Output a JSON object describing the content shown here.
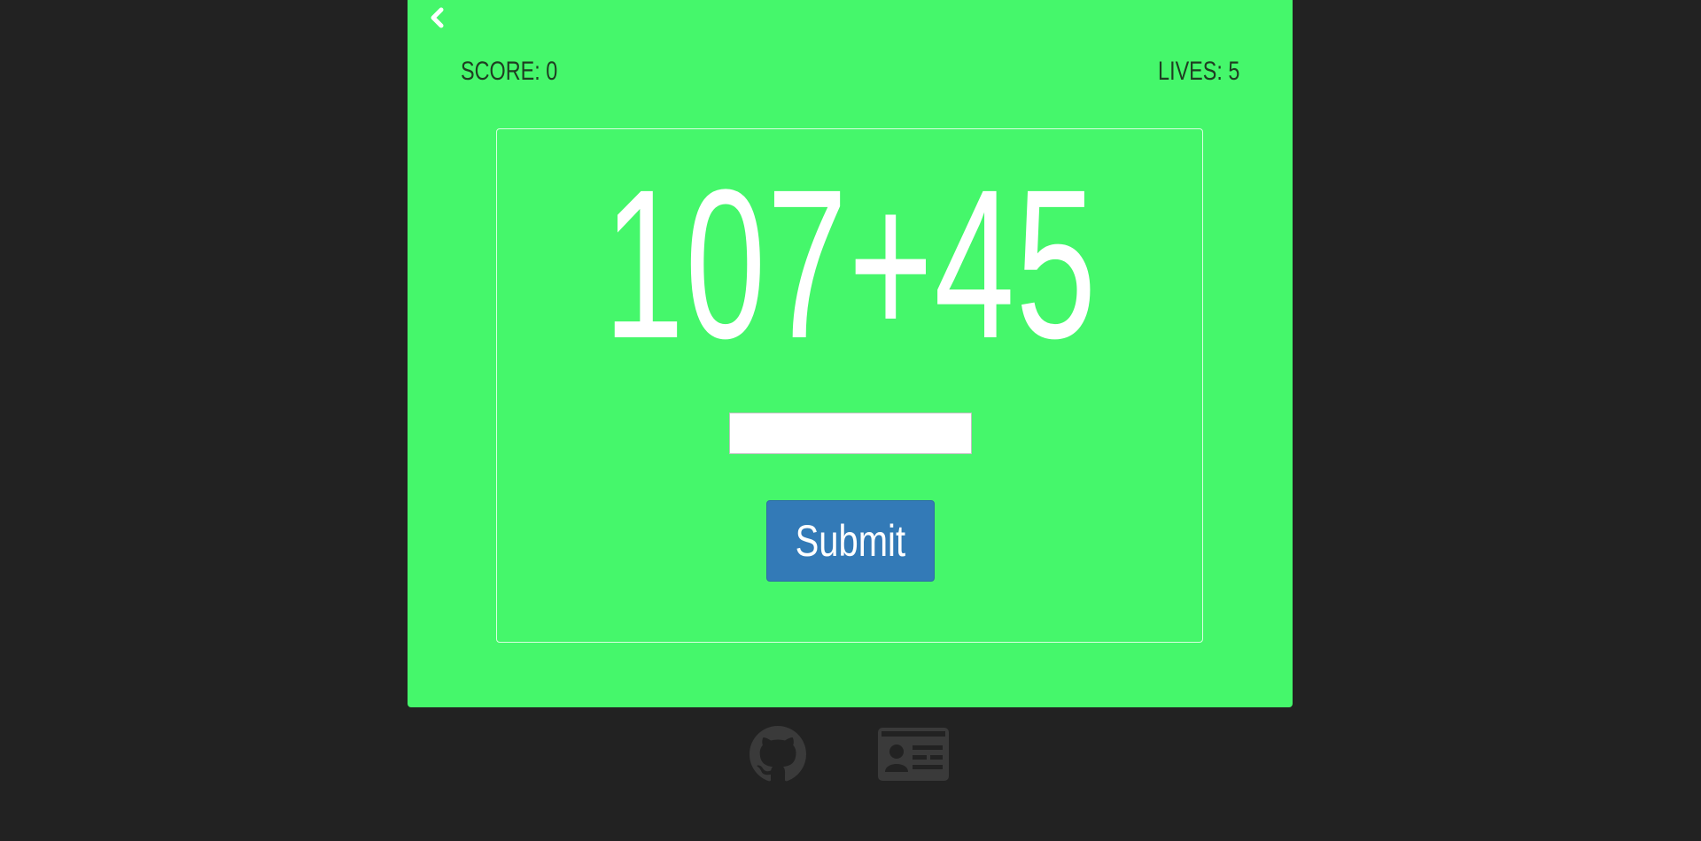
{
  "game": {
    "score_text": "SCORE: 0",
    "lives_text": "LIVES: 5",
    "problem": "107+45",
    "answer": {
      "value": "",
      "placeholder": ""
    },
    "submit_label": "Submit"
  },
  "icons": {
    "back": "chevron-left-icon",
    "github": "github-icon",
    "contact": "id-card-icon"
  },
  "colors": {
    "background": "#222222",
    "card": "#45f76b",
    "button": "#337ab7",
    "text_dark": "#1f3d22",
    "icon_gray": "#3a3a3a"
  }
}
